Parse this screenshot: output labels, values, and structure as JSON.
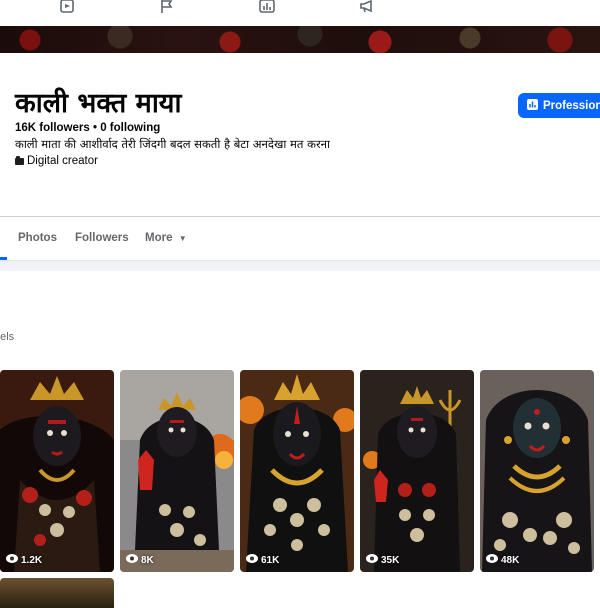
{
  "profile": {
    "name": "काली भक्त माया",
    "stats": "16K followers • 0 following",
    "bio": "काली माता की आशीर्वाद तेरी जिंदगी बदल सकती है बेटा अनदेखा मत करना",
    "category": "Digital creator"
  },
  "actions": {
    "professional_label": "Professiona"
  },
  "tabs": [
    {
      "label": "Photos"
    },
    {
      "label": "Followers"
    },
    {
      "label": "More"
    }
  ],
  "section": {
    "label": "eels"
  },
  "reels": [
    {
      "views": "1.2K"
    },
    {
      "views": "8K"
    },
    {
      "views": "61K"
    },
    {
      "views": "35K"
    },
    {
      "views": "48K"
    }
  ],
  "icons": {
    "nav": [
      "video-icon",
      "flag-icon",
      "chart-icon",
      "megaphone-icon"
    ],
    "professional": "dashboard-icon",
    "category": "briefcase-icon",
    "more": "caret-down-icon",
    "views": "eye-icon"
  },
  "colors": {
    "accent": "#0866ff",
    "text_primary": "#050505",
    "text_secondary": "#65676b",
    "divider": "#ced0d4"
  }
}
